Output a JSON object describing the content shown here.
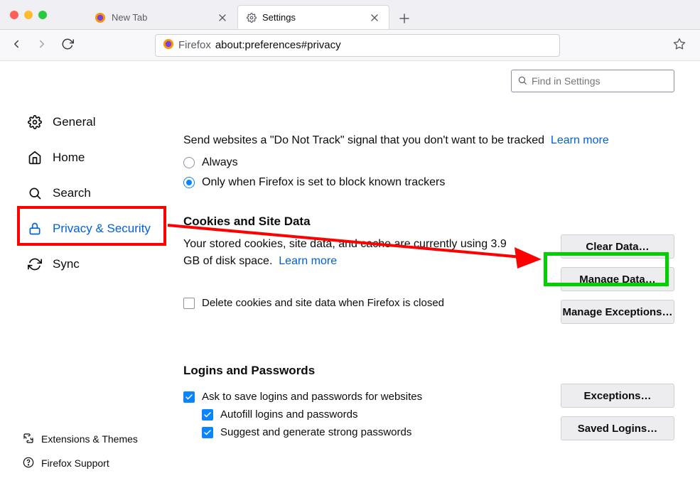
{
  "tabs": [
    {
      "label": "New Tab",
      "active": false
    },
    {
      "label": "Settings",
      "active": true
    }
  ],
  "urlbar": {
    "identity": "Firefox",
    "address": "about:preferences#privacy"
  },
  "search": {
    "placeholder": "Find in Settings"
  },
  "sidebar": {
    "items": [
      {
        "label": "General",
        "icon": "gear-icon"
      },
      {
        "label": "Home",
        "icon": "home-icon"
      },
      {
        "label": "Search",
        "icon": "search-icon"
      },
      {
        "label": "Privacy & Security",
        "icon": "lock-icon",
        "active": true
      },
      {
        "label": "Sync",
        "icon": "sync-icon"
      }
    ],
    "bottom": [
      {
        "label": "Extensions & Themes",
        "icon": "puzzle-icon"
      },
      {
        "label": "Firefox Support",
        "icon": "help-icon"
      }
    ]
  },
  "dnt": {
    "text": "Send websites a \"Do Not Track\" signal that you don't want to be tracked",
    "learn_more": "Learn more",
    "options": {
      "always": "Always",
      "only_when": "Only when Firefox is set to block known trackers"
    }
  },
  "cookies_section": {
    "heading": "Cookies and Site Data",
    "usage": "Your stored cookies, site data, and cache are currently using 3.9 GB of disk space.",
    "learn_more": "Learn more",
    "delete_on_close": "Delete cookies and site data when Firefox is closed",
    "buttons": {
      "clear": "Clear Data…",
      "manage": "Manage Data…",
      "exceptions": "Manage Exceptions…"
    }
  },
  "logins_section": {
    "heading": "Logins and Passwords",
    "ask_save": "Ask to save logins and passwords for websites",
    "autofill": "Autofill logins and passwords",
    "suggest": "Suggest and generate strong passwords",
    "buttons": {
      "exceptions": "Exceptions…",
      "saved": "Saved Logins…"
    }
  }
}
